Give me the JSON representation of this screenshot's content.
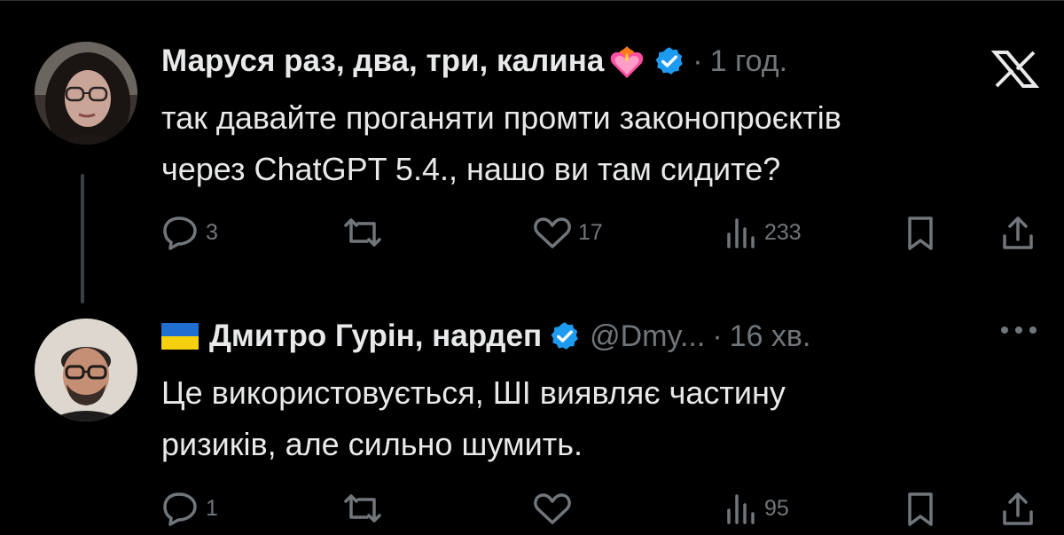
{
  "tweets": [
    {
      "author": "Маруся раз, два, три, калина",
      "time": "1 год.",
      "text_lines": [
        "так давайте проганяти промти законопроєктів",
        "через ChatGPT 5.4., нашо ви там сидите?"
      ],
      "replies": "3",
      "retweets": "",
      "likes": "17",
      "views": "233"
    },
    {
      "author": "Дмитро Гурін, нардеп",
      "handle": "@Dmy...",
      "time": "16 хв.",
      "text_lines": [
        "Це використовується, ШІ виявляє частину",
        "ризиків, але сильно шумить."
      ],
      "replies": "1",
      "retweets": "",
      "likes": "",
      "views": "95"
    }
  ],
  "ui": {
    "separator": "·"
  },
  "colors": {
    "background": "#000000",
    "text": "#e7e9ea",
    "muted": "#71767b",
    "verified": "#1d9bf0"
  },
  "icons": [
    "heart-on-fire-emoji",
    "verified-badge-icon",
    "x-logo-icon",
    "ukraine-flag-icon",
    "more-icon",
    "reply-icon",
    "retweet-icon",
    "like-icon",
    "views-icon",
    "bookmark-icon",
    "share-icon"
  ]
}
